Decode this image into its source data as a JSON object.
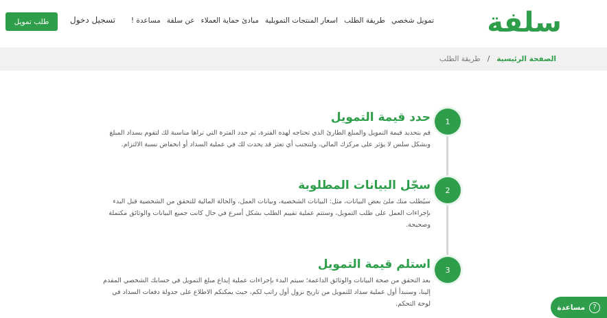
{
  "header": {
    "logo_text": "سلفة",
    "nav": [
      {
        "label": "تمويل شخصي"
      },
      {
        "label": "طريقة الطلب"
      },
      {
        "label": "اسعار المنتجات التمويلية"
      },
      {
        "label": "مبادئ حماية العملاء"
      },
      {
        "label": "عن سلفة"
      },
      {
        "label": "مساعدة !"
      }
    ],
    "login_label": "تسجيل دخول",
    "apply_label": "طلب تمويل"
  },
  "breadcrumb": {
    "home": "الصفحة الرئيسية",
    "separator": "/",
    "current": "طريقة الطلب"
  },
  "steps": [
    {
      "number": "1",
      "title": "حدد قيمة التمويل",
      "body": "قم بتحديد قيمة التمويل والمبلغ الطارئ الذي تحتاجه لهذه الفترة، ثم حدد الفترة التي تراها مناسبة لك لتقوم بسداد المبلغ وبشكل سلس لا يؤثر على مركزك المالي، ولتتجنب أي تعثر قد يحدث لك في عملية السداد أو انخفاض نسبة الالتزام."
    },
    {
      "number": "2",
      "title": "سجّل البيانات المطلوبة",
      "body": "سيُطلب منك ملئ بعض البيانات، مثل: البيانات الشخصية، وبيانات العمل، والحالة المالية للتحقق من الشخصية قبل البدء بإجراءات العمل على طلب التمويل، وستتم عملية تقييم الطلب بشكل أسرع في حال كانت جميع البيانات والوثائق مكتملة وصحيحة."
    },
    {
      "number": "3",
      "title": "استلم قيمة التمويل",
      "body": "بعد التحقق من صحة البيانات والوثائق الداعمة؛ سيتم البدء بإجراءات عملية إيداع مبلغ التمويل في حسابك الشخصي المقدم إلينا، وسنبدأ أول عملية سداد للتمويل من تاريخ نزول أول راتب لكم، حيث يمكنكم الاطلاع على جدولة دفعات السداد في لوحة التحكم."
    }
  ],
  "help_button": {
    "label": "مساعدة",
    "icon": "help-circle-icon"
  },
  "colors": {
    "brand_green": "#2e9e4a",
    "breadcrumb_bg": "#f1f1f1",
    "timeline_line": "#d6d6d6"
  }
}
